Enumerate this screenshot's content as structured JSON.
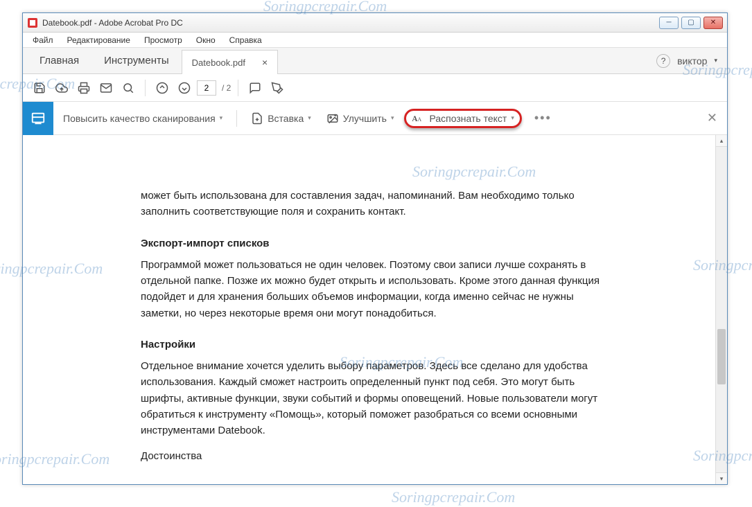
{
  "window": {
    "title": "Datebook.pdf - Adobe Acrobat Pro DC"
  },
  "menubar": [
    "Файл",
    "Редактирование",
    "Просмотр",
    "Окно",
    "Справка"
  ],
  "tabs": {
    "home": "Главная",
    "tools": "Инструменты",
    "doc": "Datebook.pdf"
  },
  "user": {
    "name": "виктор"
  },
  "page": {
    "current": "2",
    "total": "/  2"
  },
  "toolsbar": {
    "main": "Повысить качество сканирования",
    "insert": "Вставка",
    "enhance": "Улучшить",
    "recognize": "Распознать текст"
  },
  "doc": {
    "p1": "может быть использована для составления задач, напоминаний. Вам необходимо только заполнить соответствующие поля и сохранить контакт.",
    "h1": "Экспорт-импорт списков",
    "p2": "Программой может пользоваться не один человек. Поэтому свои записи лучше сохранять в отдельной папке. Позже их можно будет открыть и использовать. Кроме этого данная функция подойдет и для хранения больших объемов информации, когда именно сейчас не нужны заметки, но через некоторые время они могут понадобиться.",
    "h2": "Настройки",
    "p3": "Отдельное внимание хочется уделить выбору параметров. Здесь все сделано для удобства использования. Каждый сможет настроить определенный пункт под себя. Это могут быть шрифты, активные функции, звуки событий и формы оповещений. Новые пользователи могут обратиться к инструменту «Помощь», который поможет разобраться со всеми основными инструментами Datebook.",
    "h3": "Достоинства"
  },
  "watermark": "Soringpcrepair.Com"
}
